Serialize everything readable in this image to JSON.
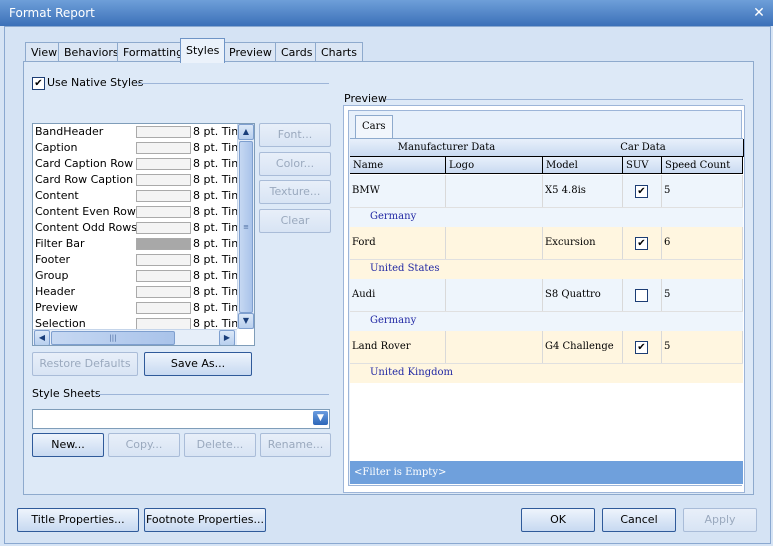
{
  "window": {
    "title": "Format Report"
  },
  "tabs": [
    "View",
    "Behaviors",
    "Formatting",
    "Styles",
    "Preview",
    "Cards",
    "Charts"
  ],
  "active_tab": "Styles",
  "native_styles": {
    "label": "Use Native Styles",
    "checked": true
  },
  "styles": [
    {
      "name": "BandHeader",
      "font": "8 pt. Tin"
    },
    {
      "name": "Caption",
      "font": "8 pt. Tin"
    },
    {
      "name": "Card Caption Row",
      "font": "8 pt. Tin"
    },
    {
      "name": "Card Row Caption",
      "font": "8 pt. Tin"
    },
    {
      "name": "Content",
      "font": "8 pt. Tin"
    },
    {
      "name": "Content Even Rows",
      "font": "8 pt. Tin"
    },
    {
      "name": "Content Odd Rows",
      "font": "8 pt. Tin"
    },
    {
      "name": "Filter Bar",
      "font": "8 pt. Tin"
    },
    {
      "name": "Footer",
      "font": "8 pt. Tin"
    },
    {
      "name": "Group",
      "font": "8 pt. Tin"
    },
    {
      "name": "Header",
      "font": "8 pt. Tin"
    },
    {
      "name": "Preview",
      "font": "8 pt. Tin"
    },
    {
      "name": "Selection",
      "font": "8 pt. Tin"
    }
  ],
  "filter_bar_swatch_color": "#a8a8a8",
  "style_buttons": {
    "font": "Font...",
    "color": "Color...",
    "texture": "Texture...",
    "clear": "Clear"
  },
  "restore_defaults": "Restore Defaults",
  "save_as": "Save As...",
  "style_sheets": {
    "label": "Style Sheets",
    "selected": "",
    "new": "New...",
    "copy": "Copy...",
    "delete": "Delete...",
    "rename": "Rename..."
  },
  "preview": {
    "label": "Preview",
    "tab": "Cars",
    "bands": {
      "manufacturer": "Manufacturer Data",
      "car": "Car Data"
    },
    "columns": {
      "name": "Name",
      "logo": "Logo",
      "model": "Model",
      "suv": "SUV",
      "speed": "Speed Count"
    },
    "rows": [
      {
        "name": "BMW",
        "model": "X5 4.8is",
        "suv": true,
        "speed": "5",
        "country": "Germany",
        "bg": "#eef5fc"
      },
      {
        "name": "Ford",
        "model": "Excursion",
        "suv": true,
        "speed": "6",
        "country": "United States",
        "bg": "#fff6e0"
      },
      {
        "name": "Audi",
        "model": "S8 Quattro",
        "suv": false,
        "speed": "5",
        "country": "Germany",
        "bg": "#eef5fc"
      },
      {
        "name": "Land Rover",
        "model": "G4 Challenge",
        "suv": true,
        "speed": "5",
        "country": "United Kingdom",
        "bg": "#fff6e0"
      }
    ],
    "filter_text": "<Filter is Empty>"
  },
  "footer": {
    "title_properties": "Title Properties...",
    "footnote_properties": "Footnote Properties...",
    "ok": "OK",
    "cancel": "Cancel",
    "apply": "Apply"
  },
  "colors": {
    "accent": "#3b70b8",
    "filter_bar": "#6fa0dc",
    "country_text": "#2229a4"
  }
}
